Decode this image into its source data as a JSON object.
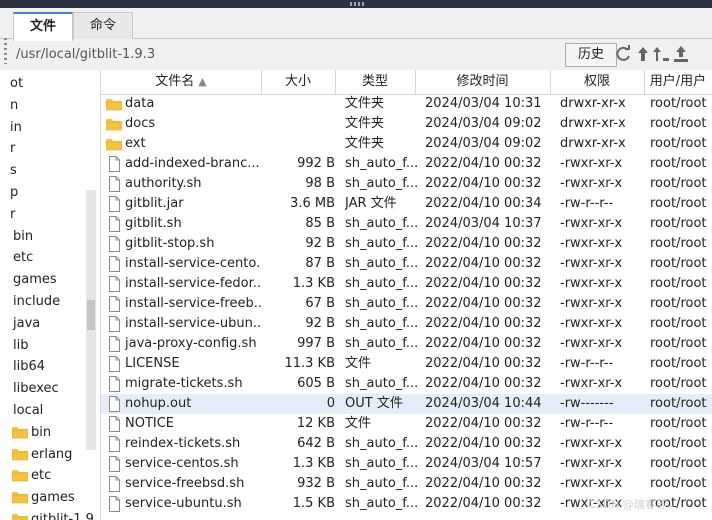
{
  "tabs": [
    {
      "label": "文件",
      "active": true
    },
    {
      "label": "命令",
      "active": false
    }
  ],
  "path": {
    "value": "/usr/local/gitblit-1.9.3",
    "history_label": "历史",
    "icons": [
      "refresh-icon",
      "upload-icon",
      "sort-up-icon",
      "upload-tray-icon"
    ]
  },
  "sidebar": {
    "items": [
      {
        "label": "ot",
        "folder": false
      },
      {
        "label": "n",
        "folder": false
      },
      {
        "label": "in",
        "folder": false
      },
      {
        "label": "r",
        "folder": false
      },
      {
        "label": "s",
        "folder": false
      },
      {
        "label": "p",
        "folder": false
      },
      {
        "label": "r",
        "folder": false
      },
      {
        "label": "bin",
        "folder": false
      },
      {
        "label": "etc",
        "folder": false
      },
      {
        "label": "games",
        "folder": false
      },
      {
        "label": "include",
        "folder": false
      },
      {
        "label": "java",
        "folder": false
      },
      {
        "label": "lib",
        "folder": false
      },
      {
        "label": "lib64",
        "folder": false
      },
      {
        "label": "libexec",
        "folder": false
      },
      {
        "label": "local",
        "folder": false
      },
      {
        "label": "bin",
        "folder": true
      },
      {
        "label": "erlang",
        "folder": true
      },
      {
        "label": "etc",
        "folder": true
      },
      {
        "label": "games",
        "folder": true
      },
      {
        "label": "gitblit-1.9",
        "folder": true
      }
    ]
  },
  "table": {
    "headers": {
      "name": "文件名",
      "size": "大小",
      "type": "类型",
      "date": "修改时间",
      "perm": "权限",
      "owner": "用户/用户"
    },
    "rows": [
      {
        "icon": "folder",
        "name": "data",
        "size": "",
        "type": "文件夹",
        "date": "2024/03/04 10:31",
        "perm": "drwxr-xr-x",
        "owner": "root/root"
      },
      {
        "icon": "folder",
        "name": "docs",
        "size": "",
        "type": "文件夹",
        "date": "2024/03/04 09:02",
        "perm": "drwxr-xr-x",
        "owner": "root/root"
      },
      {
        "icon": "folder",
        "name": "ext",
        "size": "",
        "type": "文件夹",
        "date": "2024/03/04 09:02",
        "perm": "drwxr-xr-x",
        "owner": "root/root"
      },
      {
        "icon": "file",
        "name": "add-indexed-branc...",
        "size": "992 B",
        "type": "sh_auto_f...",
        "date": "2022/04/10 00:32",
        "perm": "-rwxr-xr-x",
        "owner": "root/root"
      },
      {
        "icon": "file",
        "name": "authority.sh",
        "size": "98 B",
        "type": "sh_auto_f...",
        "date": "2022/04/10 00:32",
        "perm": "-rwxr-xr-x",
        "owner": "root/root"
      },
      {
        "icon": "file",
        "name": "gitblit.jar",
        "size": "3.6 MB",
        "type": "JAR 文件",
        "date": "2022/04/10 00:34",
        "perm": "-rw-r--r--",
        "owner": "root/root"
      },
      {
        "icon": "file",
        "name": "gitblit.sh",
        "size": "85 B",
        "type": "sh_auto_f...",
        "date": "2024/03/04 10:37",
        "perm": "-rwxr-xr-x",
        "owner": "root/root"
      },
      {
        "icon": "file",
        "name": "gitblit-stop.sh",
        "size": "92 B",
        "type": "sh_auto_f...",
        "date": "2022/04/10 00:32",
        "perm": "-rwxr-xr-x",
        "owner": "root/root"
      },
      {
        "icon": "file",
        "name": "install-service-cento...",
        "size": "87 B",
        "type": "sh_auto_f...",
        "date": "2022/04/10 00:32",
        "perm": "-rwxr-xr-x",
        "owner": "root/root"
      },
      {
        "icon": "file",
        "name": "install-service-fedor...",
        "size": "1.3 KB",
        "type": "sh_auto_f...",
        "date": "2022/04/10 00:32",
        "perm": "-rwxr-xr-x",
        "owner": "root/root"
      },
      {
        "icon": "file",
        "name": "install-service-freeb...",
        "size": "67 B",
        "type": "sh_auto_f...",
        "date": "2022/04/10 00:32",
        "perm": "-rwxr-xr-x",
        "owner": "root/root"
      },
      {
        "icon": "file",
        "name": "install-service-ubun...",
        "size": "92 B",
        "type": "sh_auto_f...",
        "date": "2022/04/10 00:32",
        "perm": "-rwxr-xr-x",
        "owner": "root/root"
      },
      {
        "icon": "file",
        "name": "java-proxy-config.sh",
        "size": "997 B",
        "type": "sh_auto_f...",
        "date": "2022/04/10 00:32",
        "perm": "-rwxr-xr-x",
        "owner": "root/root"
      },
      {
        "icon": "file",
        "name": "LICENSE",
        "size": "11.3 KB",
        "type": "文件",
        "date": "2022/04/10 00:32",
        "perm": "-rw-r--r--",
        "owner": "root/root"
      },
      {
        "icon": "file",
        "name": "migrate-tickets.sh",
        "size": "605 B",
        "type": "sh_auto_f...",
        "date": "2022/04/10 00:32",
        "perm": "-rwxr-xr-x",
        "owner": "root/root"
      },
      {
        "icon": "file",
        "name": "nohup.out",
        "size": "0",
        "type": "OUT 文件",
        "date": "2024/03/04 10:44",
        "perm": "-rw-------",
        "owner": "root/root",
        "selected": true
      },
      {
        "icon": "file",
        "name": "NOTICE",
        "size": "12 KB",
        "type": "文件",
        "date": "2022/04/10 00:32",
        "perm": "-rw-r--r--",
        "owner": "root/root"
      },
      {
        "icon": "file",
        "name": "reindex-tickets.sh",
        "size": "642 B",
        "type": "sh_auto_f...",
        "date": "2022/04/10 00:32",
        "perm": "-rwxr-xr-x",
        "owner": "root/root"
      },
      {
        "icon": "file",
        "name": "service-centos.sh",
        "size": "1.3 KB",
        "type": "sh_auto_f...",
        "date": "2024/03/04 10:57",
        "perm": "-rwxr-xr-x",
        "owner": "root/root"
      },
      {
        "icon": "file",
        "name": "service-freebsd.sh",
        "size": "932 B",
        "type": "sh_auto_f...",
        "date": "2022/04/10 00:32",
        "perm": "-rwxr-xr-x",
        "owner": "root/root"
      },
      {
        "icon": "file",
        "name": "service-ubuntu.sh",
        "size": "1.5 KB",
        "type": "sh_auto_f...",
        "date": "2022/04/10 00:32",
        "perm": "-rwxr-xr-x",
        "owner": "root/root"
      }
    ]
  },
  "watermark": "CSDN @瑞春苏",
  "colors": {
    "folder": "#f5c242",
    "folder_dark": "#e0a92a",
    "accent": "#3b82d6",
    "selected_row": "#e5eef8"
  }
}
